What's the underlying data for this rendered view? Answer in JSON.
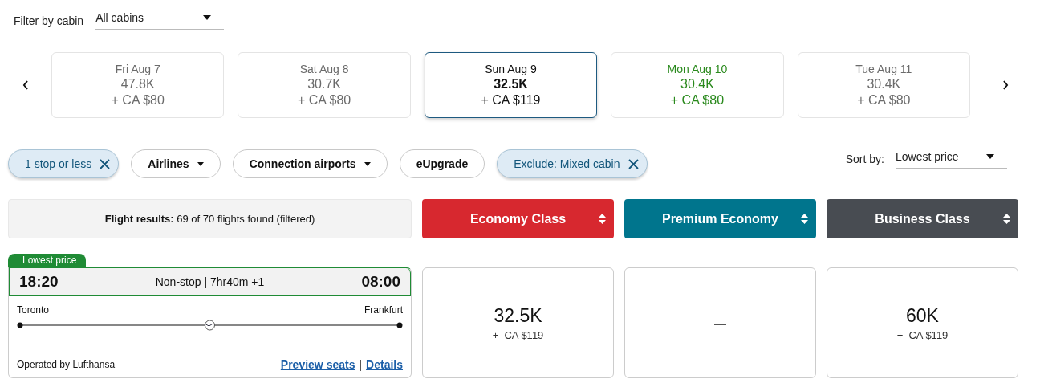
{
  "cabin_filter": {
    "label": "Filter by cabin",
    "value": "All cabins"
  },
  "dates": [
    {
      "day": "Fri Aug 7",
      "points": "47.8K",
      "fee": "+ CA $80",
      "selected": false,
      "lowest": false
    },
    {
      "day": "Sat Aug 8",
      "points": "30.7K",
      "fee": "+ CA $80",
      "selected": false,
      "lowest": false
    },
    {
      "day": "Sun Aug 9",
      "points": "32.5K",
      "fee": "+ CA $119",
      "selected": true,
      "lowest": false
    },
    {
      "day": "Mon Aug 10",
      "points": "30.4K",
      "fee": "+ CA $80",
      "selected": false,
      "lowest": true
    },
    {
      "day": "Tue Aug 11",
      "points": "30.4K",
      "fee": "+ CA $80",
      "selected": false,
      "lowest": false
    }
  ],
  "filters": [
    {
      "label": "1 stop or less",
      "kind": "applied"
    },
    {
      "label": "Airlines",
      "kind": "menu"
    },
    {
      "label": "Connection airports",
      "kind": "menu"
    },
    {
      "label": "eUpgrade",
      "kind": "plain"
    },
    {
      "label": "Exclude: Mixed cabin",
      "kind": "applied"
    }
  ],
  "sort": {
    "label": "Sort by:",
    "value": "Lowest price"
  },
  "results_summary": "**Flight results:** 69 of 70 flights found (filtered)",
  "cabins": [
    {
      "label": "Economy Class",
      "color": "#d7282f"
    },
    {
      "label": "Premium Economy",
      "color": "#00758d"
    },
    {
      "label": "Business Class",
      "color": "#484c52"
    }
  ],
  "flights": [
    {
      "badge": "Lowest price",
      "depart": "18:20",
      "arrive": "08:00",
      "summary": "Non-stop | 7hr40m +1",
      "origin": "Toronto",
      "destination": "Frankfurt",
      "operator": "Operated by Lufthansa",
      "links": [
        "Preview seats",
        "Details"
      ],
      "link_separator": "|",
      "fares": [
        {
          "kind": "price",
          "points": "32.5K",
          "fee": "+  CA $119"
        },
        {
          "kind": "none",
          "text": "—"
        },
        {
          "kind": "price",
          "points": "60K",
          "fee": "+  CA $119"
        }
      ]
    }
  ]
}
